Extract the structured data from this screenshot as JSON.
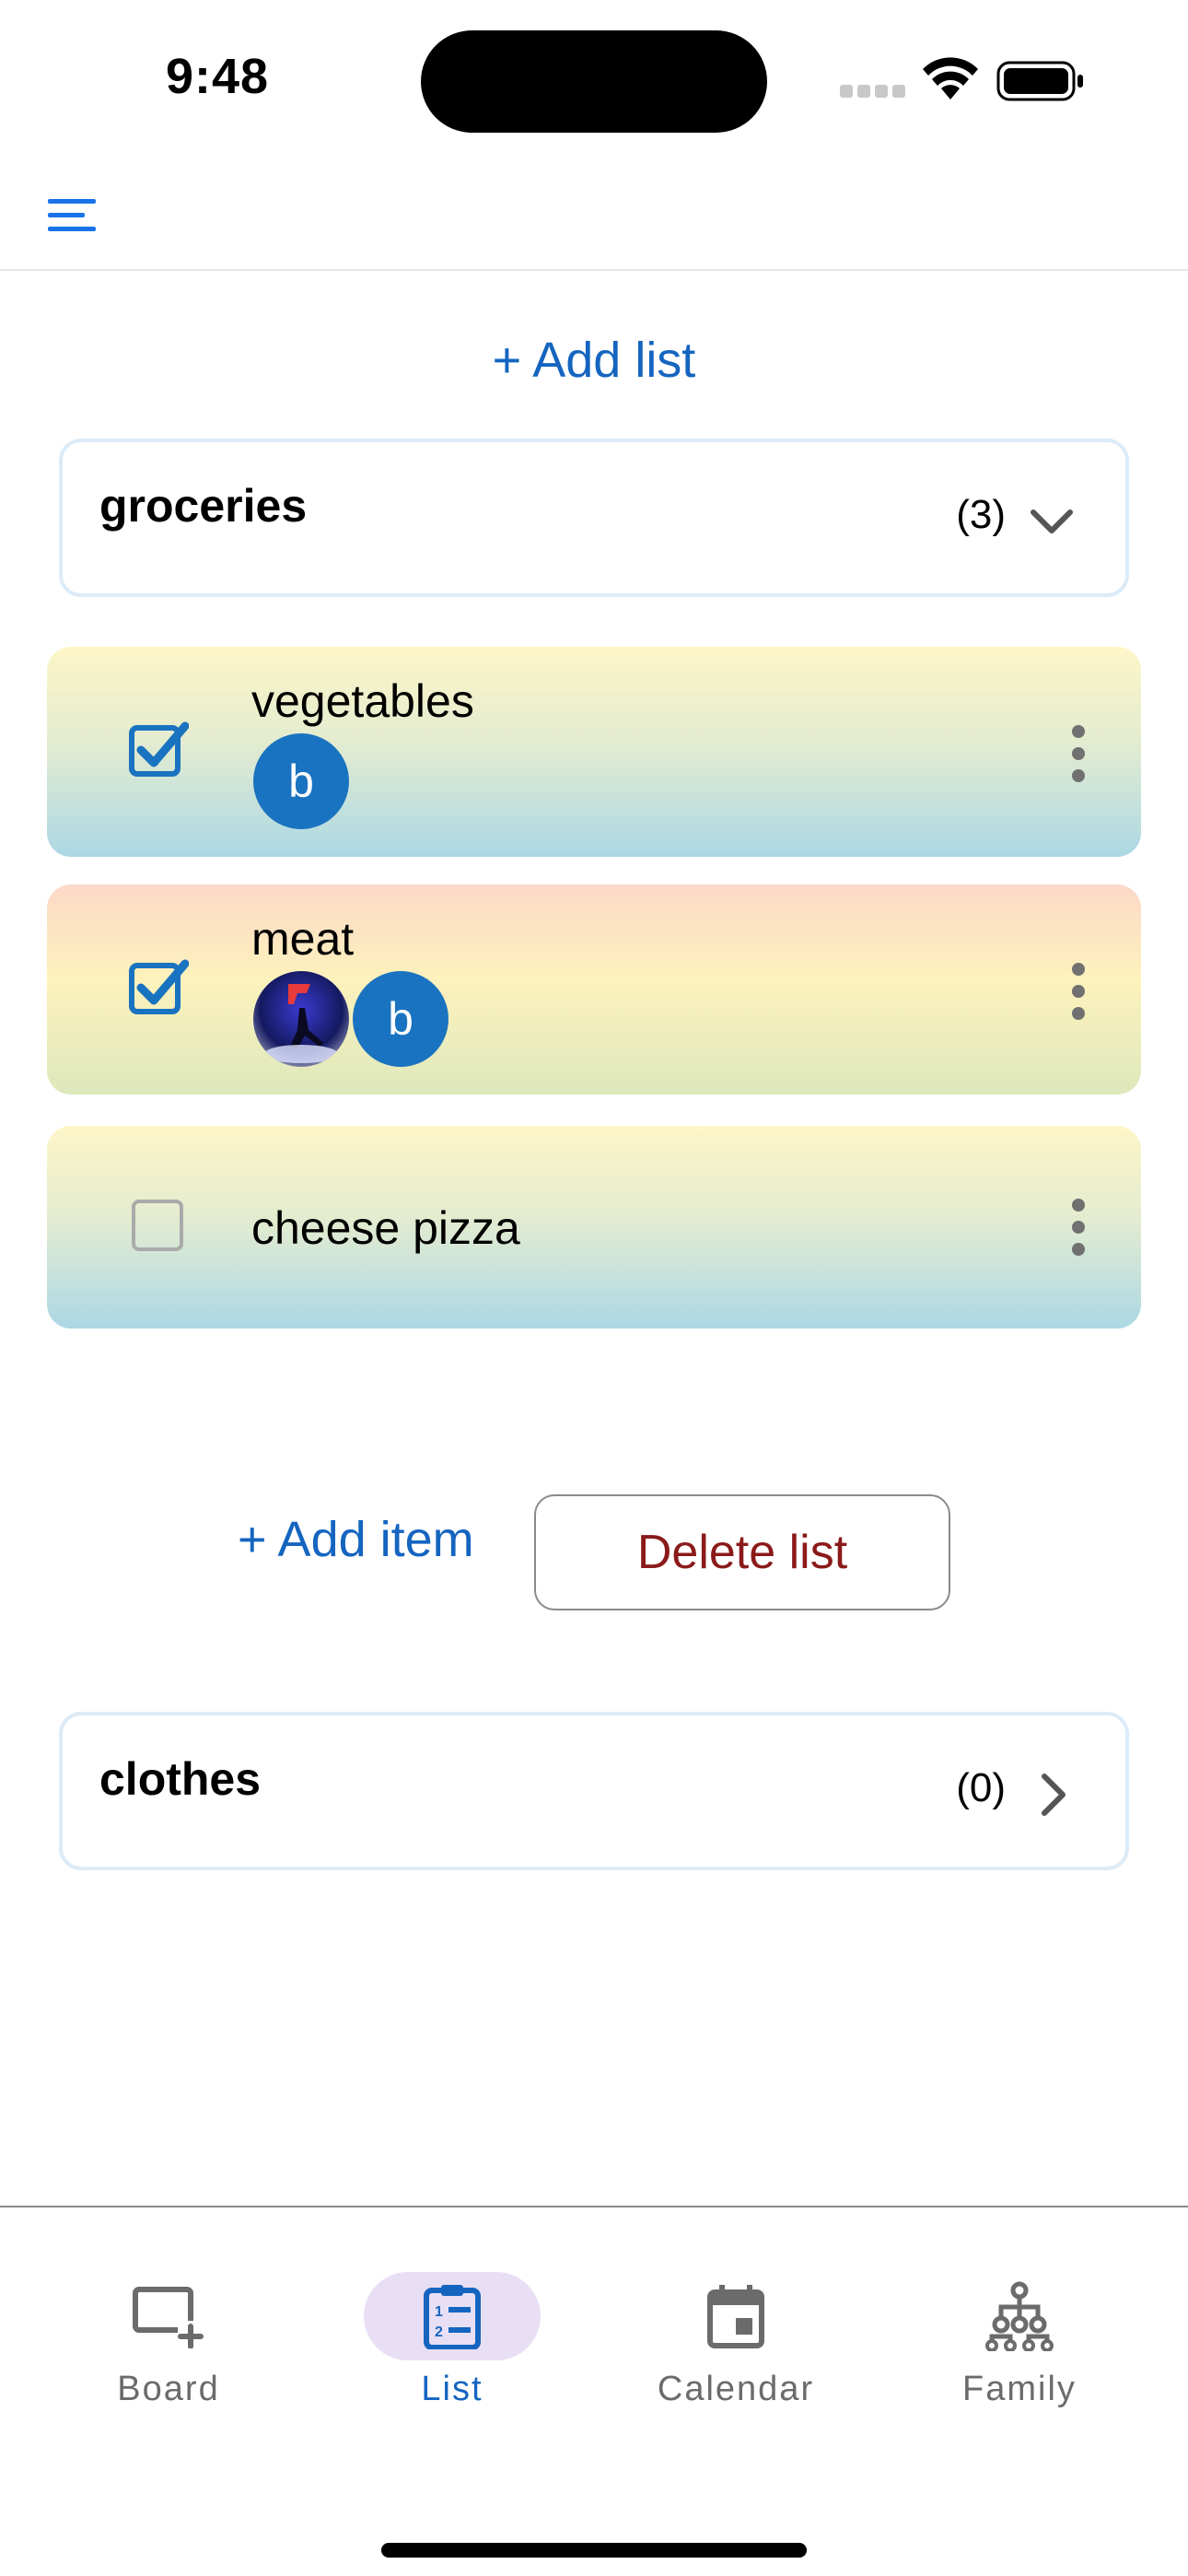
{
  "status_bar": {
    "time": "9:48"
  },
  "app_bar": {
    "menu_icon": "hamburger-menu-icon"
  },
  "add_list_label": "+ Add list",
  "lists": [
    {
      "name": "groceries",
      "count": "(3)",
      "expanded": true
    },
    {
      "name": "clothes",
      "count": "(0)",
      "expanded": false
    }
  ],
  "items": [
    {
      "label": "vegetables",
      "checked": true,
      "avatars": [
        "b"
      ]
    },
    {
      "label": "meat",
      "checked": true,
      "avatars": [
        "photo",
        "b"
      ]
    },
    {
      "label": "cheese pizza",
      "checked": false,
      "avatars": []
    }
  ],
  "actions": {
    "add_item": "+ Add item",
    "delete_list": "Delete list"
  },
  "bottom_nav": [
    {
      "label": "Board",
      "icon": "board-add-icon",
      "active": false
    },
    {
      "label": "List",
      "icon": "clipboard-list-icon",
      "active": true
    },
    {
      "label": "Calendar",
      "icon": "calendar-icon",
      "active": false
    },
    {
      "label": "Family",
      "icon": "family-tree-icon",
      "active": false
    }
  ],
  "colors": {
    "accent": "#1565c0",
    "danger": "#8b1a1a",
    "active_nav_bg": "#e8dff5"
  }
}
